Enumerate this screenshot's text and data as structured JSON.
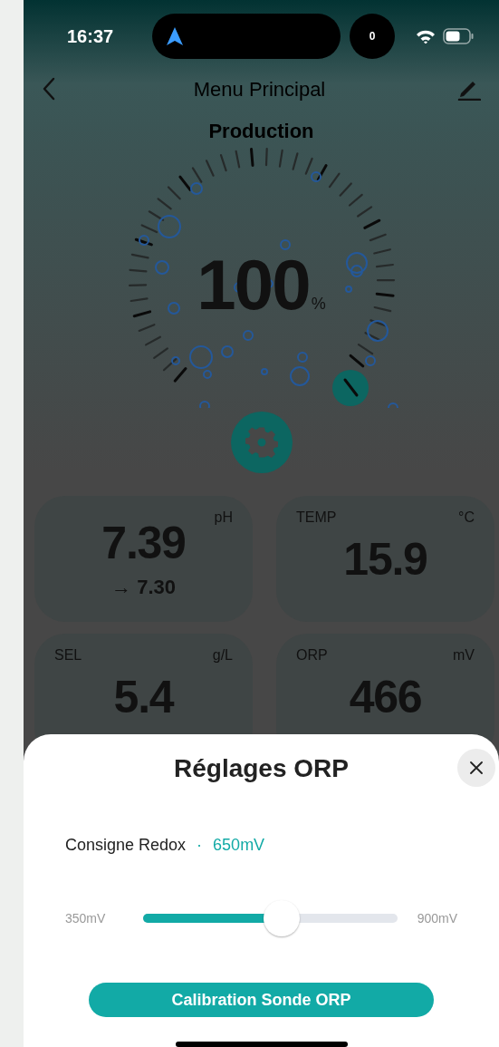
{
  "status_bar": {
    "time": "16:37",
    "activity_count": "0"
  },
  "nav": {
    "title": "Menu Principal"
  },
  "section_title": "Production",
  "gauge": {
    "value": "100",
    "unit": "%"
  },
  "cards": [
    {
      "value": "7.39",
      "unit": "pH",
      "target": "→ 7.30"
    },
    {
      "label": "TEMP",
      "unit": "°C",
      "value": "15.9"
    },
    {
      "label": "SEL",
      "unit": "g/L",
      "value": "5.4"
    },
    {
      "label": "ORP",
      "unit": "mV",
      "value": "466"
    }
  ],
  "sheet": {
    "title": "Réglages ORP",
    "setpoint_label": "Consigne Redox",
    "separator": "·",
    "setpoint_value": "650mV",
    "slider": {
      "min_label": "350mV",
      "max_label": "900mV",
      "level": 0.545
    },
    "button": "Calibration Sonde ORP"
  }
}
